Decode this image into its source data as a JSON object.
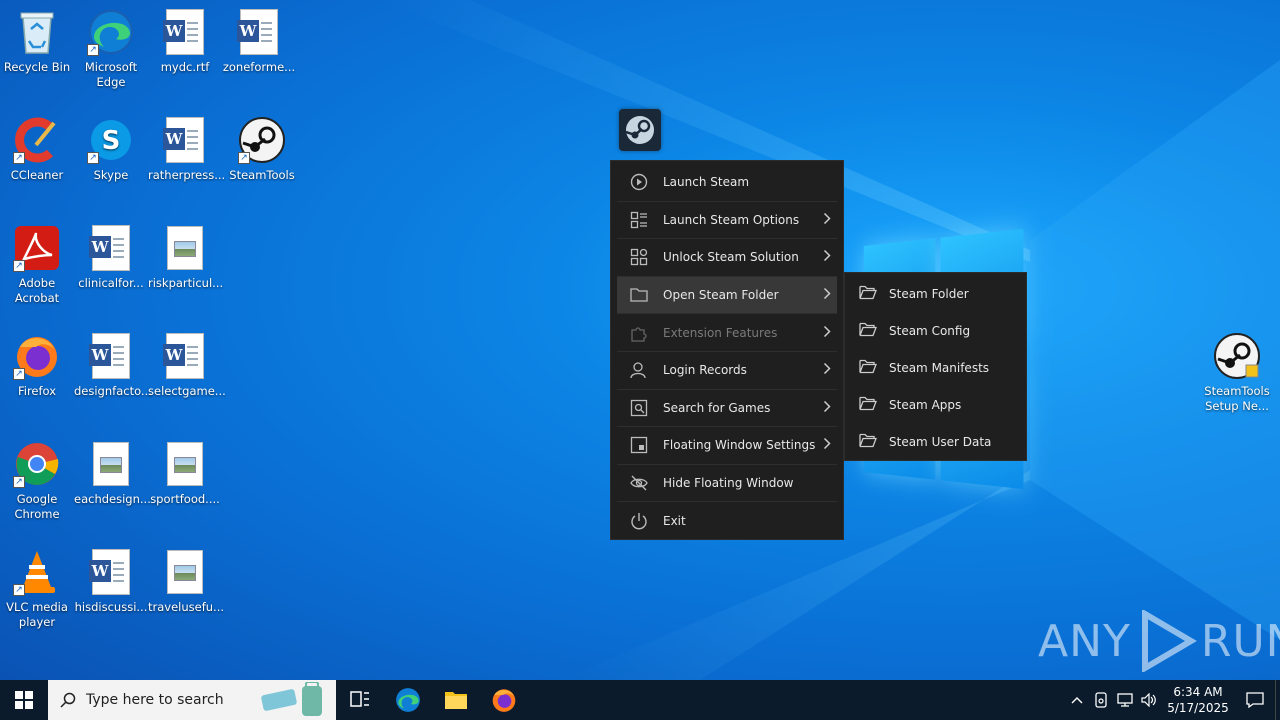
{
  "desktop": {
    "icons": [
      {
        "label": "Recycle Bin"
      },
      {
        "label": "Microsoft Edge"
      },
      {
        "label": "mydc.rtf"
      },
      {
        "label": "zoneforme..."
      },
      {
        "label": "CCleaner"
      },
      {
        "label": "Skype"
      },
      {
        "label": "ratherpress..."
      },
      {
        "label": "SteamTools"
      },
      {
        "label": "Adobe Acrobat"
      },
      {
        "label": "clinicalfor..."
      },
      {
        "label": "riskparticul..."
      },
      {
        "label": "Firefox"
      },
      {
        "label": "designfacto..."
      },
      {
        "label": "selectgame..."
      },
      {
        "label": "Google Chrome"
      },
      {
        "label": "eachdesign..."
      },
      {
        "label": "sportfood...."
      },
      {
        "label": "VLC media player"
      },
      {
        "label": "hisdiscussi..."
      },
      {
        "label": "travelusefu..."
      },
      {
        "label": "SteamTools Setup Ne..."
      }
    ]
  },
  "menu": {
    "items": [
      {
        "label": "Launch Steam",
        "icon": "play-circle-icon"
      },
      {
        "label": "Launch Steam Options",
        "icon": "options-icon"
      },
      {
        "label": "Unlock Steam Solution",
        "icon": "grid-icon"
      },
      {
        "label": "Open Steam Folder",
        "icon": "folder-icon"
      },
      {
        "label": "Extension Features",
        "icon": "puzzle-icon"
      },
      {
        "label": "Login Records",
        "icon": "user-icon"
      },
      {
        "label": "Search for Games",
        "icon": "search-window-icon"
      },
      {
        "label": "Floating Window Settings",
        "icon": "window-icon"
      },
      {
        "label": "Hide Floating Window",
        "icon": "eye-off-icon"
      },
      {
        "label": "Exit",
        "icon": "power-icon"
      }
    ]
  },
  "submenu": {
    "items": [
      {
        "label": "Steam Folder"
      },
      {
        "label": "Steam Config"
      },
      {
        "label": "Steam Manifests"
      },
      {
        "label": "Steam Apps"
      },
      {
        "label": "Steam User Data"
      }
    ]
  },
  "watermark": {
    "text_left": "ANY",
    "text_right": "RUN"
  },
  "taskbar": {
    "search_placeholder": "Type here to search",
    "time": "6:34 AM",
    "date": "5/17/2025"
  },
  "colors": {
    "menu_bg": "#1f1f1f",
    "menu_active": "#383838",
    "taskbar_bg": "#0b1b2c",
    "desktop_accent": "#0c86e6"
  }
}
